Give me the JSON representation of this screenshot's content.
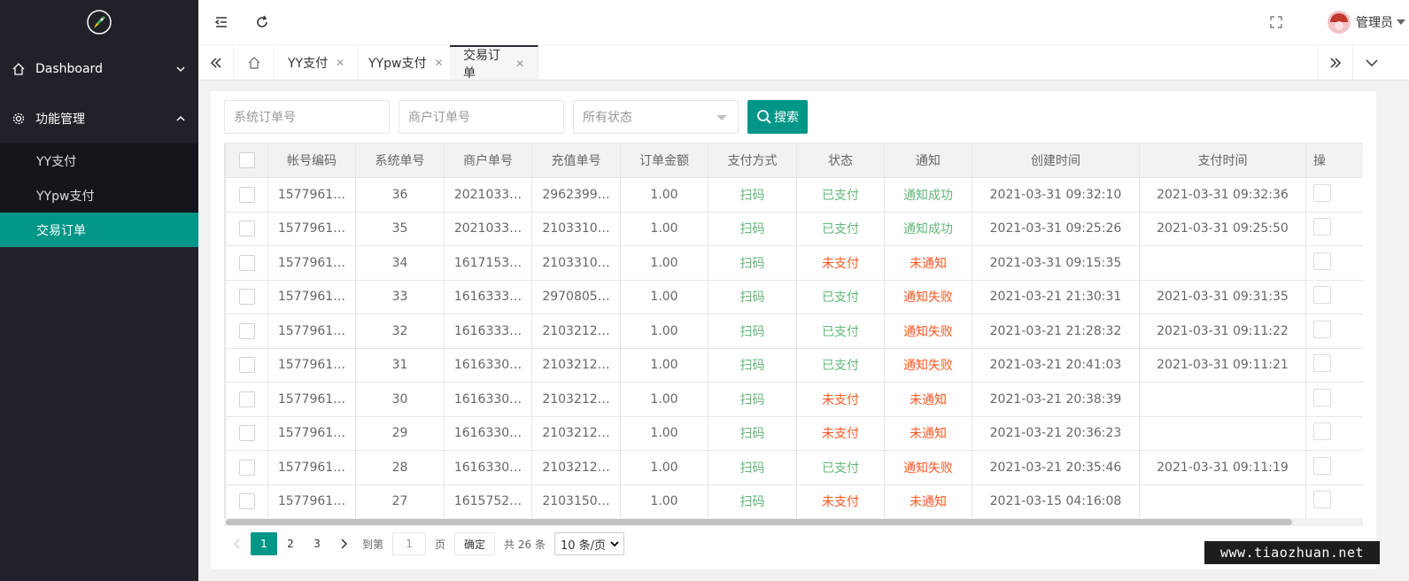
{
  "sidebar": {
    "items": [
      {
        "label": "Dashboard",
        "icon": "home-icon",
        "expanded": false
      },
      {
        "label": "功能管理",
        "icon": "gear-icon",
        "expanded": true
      }
    ],
    "children": [
      {
        "label": "YY支付",
        "active": false
      },
      {
        "label": "YYpw支付",
        "active": false
      },
      {
        "label": "交易订单",
        "active": true
      }
    ]
  },
  "header": {
    "user_name": "管理员"
  },
  "tabs": [
    {
      "label": "YY支付",
      "active": false
    },
    {
      "label": "YYpw支付",
      "active": false
    },
    {
      "label": "交易订单",
      "active": true
    }
  ],
  "search": {
    "system_order_placeholder": "系统订单号",
    "merchant_order_placeholder": "商户订单号",
    "status_selected": "所有状态",
    "search_label": "搜索"
  },
  "table": {
    "headers": [
      "帐号编码",
      "系统单号",
      "商户单号",
      "充值单号",
      "订单金额",
      "支付方式",
      "状态",
      "通知",
      "创建时间",
      "支付时间",
      "操"
    ],
    "rows": [
      {
        "account": "1577961…",
        "sys": "36",
        "merchant": "2021033…",
        "recharge": "2962399…",
        "amount": "1.00",
        "pay": "扫码",
        "status": "已支付",
        "notify": "通知成功",
        "created": "2021-03-31 09:32:10",
        "paid": "2021-03-31 09:32:36"
      },
      {
        "account": "1577961…",
        "sys": "35",
        "merchant": "2021033…",
        "recharge": "2103310…",
        "amount": "1.00",
        "pay": "扫码",
        "status": "已支付",
        "notify": "通知成功",
        "created": "2021-03-31 09:25:26",
        "paid": "2021-03-31 09:25:50"
      },
      {
        "account": "1577961…",
        "sys": "34",
        "merchant": "1617153…",
        "recharge": "2103310…",
        "amount": "1.00",
        "pay": "扫码",
        "status": "未支付",
        "notify": "未通知",
        "created": "2021-03-31 09:15:35",
        "paid": ""
      },
      {
        "account": "1577961…",
        "sys": "33",
        "merchant": "1616333…",
        "recharge": "2970805…",
        "amount": "1.00",
        "pay": "扫码",
        "status": "已支付",
        "notify": "通知失败",
        "created": "2021-03-21 21:30:31",
        "paid": "2021-03-31 09:31:35"
      },
      {
        "account": "1577961…",
        "sys": "32",
        "merchant": "1616333…",
        "recharge": "2103212…",
        "amount": "1.00",
        "pay": "扫码",
        "status": "已支付",
        "notify": "通知失败",
        "created": "2021-03-21 21:28:32",
        "paid": "2021-03-31 09:11:22"
      },
      {
        "account": "1577961…",
        "sys": "31",
        "merchant": "1616330…",
        "recharge": "2103212…",
        "amount": "1.00",
        "pay": "扫码",
        "status": "已支付",
        "notify": "通知失败",
        "created": "2021-03-21 20:41:03",
        "paid": "2021-03-31 09:11:21"
      },
      {
        "account": "1577961…",
        "sys": "30",
        "merchant": "1616330…",
        "recharge": "2103212…",
        "amount": "1.00",
        "pay": "扫码",
        "status": "未支付",
        "notify": "未通知",
        "created": "2021-03-21 20:38:39",
        "paid": ""
      },
      {
        "account": "1577961…",
        "sys": "29",
        "merchant": "1616330…",
        "recharge": "2103212…",
        "amount": "1.00",
        "pay": "扫码",
        "status": "未支付",
        "notify": "未通知",
        "created": "2021-03-21 20:36:23",
        "paid": ""
      },
      {
        "account": "1577961…",
        "sys": "28",
        "merchant": "1616330…",
        "recharge": "2103212…",
        "amount": "1.00",
        "pay": "扫码",
        "status": "已支付",
        "notify": "通知失败",
        "created": "2021-03-21 20:35:46",
        "paid": "2021-03-31 09:11:19"
      },
      {
        "account": "1577961…",
        "sys": "27",
        "merchant": "1615752…",
        "recharge": "2103150…",
        "amount": "1.00",
        "pay": "扫码",
        "status": "未支付",
        "notify": "未通知",
        "created": "2021-03-15 04:16:08",
        "paid": ""
      }
    ]
  },
  "pager": {
    "pages": [
      "1",
      "2",
      "3"
    ],
    "current": "1",
    "goto_label": "到第",
    "goto_value": "1",
    "page_unit": "页",
    "confirm_label": "确定",
    "total_label": "共 26 条",
    "page_size": "10 条/页"
  },
  "watermark": "www.tiaozhuan.net",
  "colors": {
    "accent": "#009688",
    "sidebar_bg": "#20222a",
    "success": "#5FB878",
    "danger": "#FF5722"
  }
}
